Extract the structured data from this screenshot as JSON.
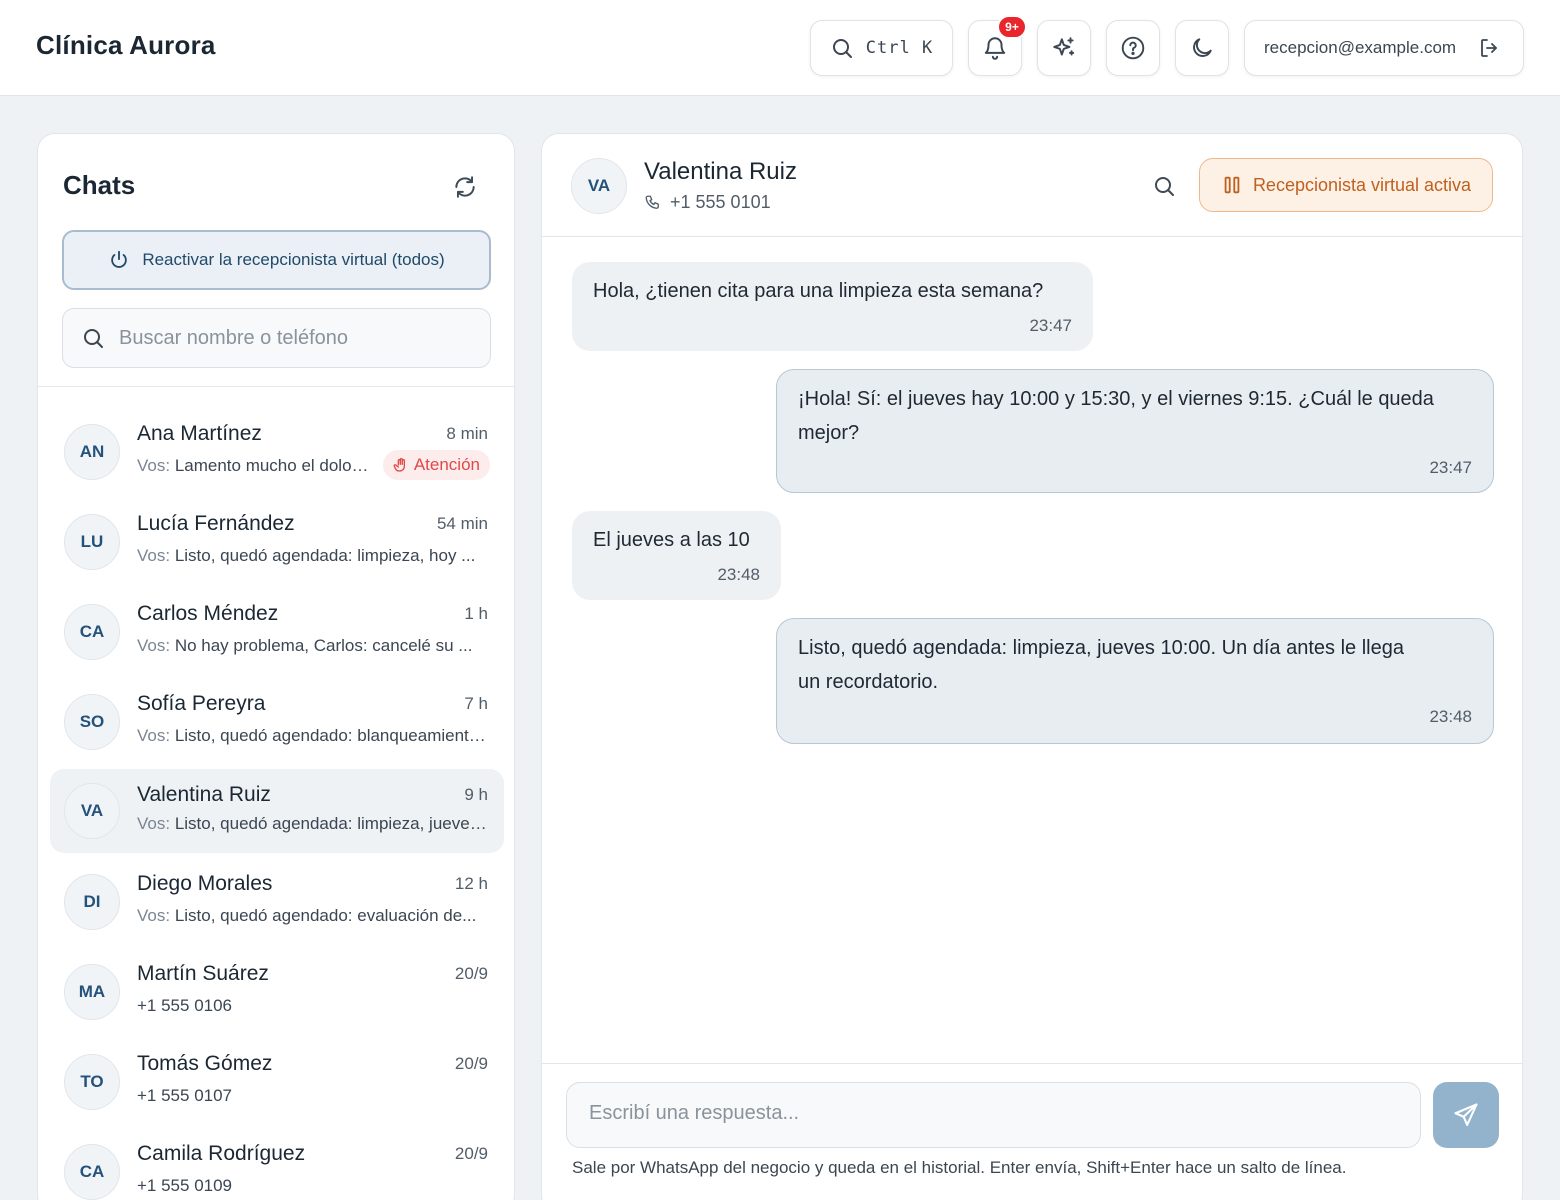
{
  "app": {
    "brand": "Clínica Aurora"
  },
  "topbar": {
    "search_shortcut": "Ctrl K",
    "notifications_badge": "9+",
    "user_email": "recepcion@example.com"
  },
  "sidebar": {
    "title": "Chats",
    "reactivate_label": "Reactivar la recepcionista virtual (todos)",
    "search_placeholder": "Buscar nombre o teléfono",
    "chats": [
      {
        "initials": "AN",
        "name": "Ana Martínez",
        "time": "8 min",
        "prefix": "Vos: ",
        "preview": "Lamento mucho el dolor...",
        "badge": "Atención"
      },
      {
        "initials": "LU",
        "name": "Lucía Fernández",
        "time": "54 min",
        "prefix": "Vos: ",
        "preview": "Listo, quedó agendada: limpieza, hoy ..."
      },
      {
        "initials": "CA",
        "name": "Carlos Méndez",
        "time": "1 h",
        "prefix": "Vos: ",
        "preview": "No hay problema, Carlos: cancelé su ..."
      },
      {
        "initials": "SO",
        "name": "Sofía Pereyra",
        "time": "7 h",
        "prefix": "Vos: ",
        "preview": "Listo, quedó agendado: blanqueamiento..."
      },
      {
        "initials": "VA",
        "name": "Valentina Ruiz",
        "time": "9 h",
        "prefix": "Vos: ",
        "preview": "Listo, quedó agendada: limpieza, jueves...",
        "active": true
      },
      {
        "initials": "DI",
        "name": "Diego Morales",
        "time": "12 h",
        "prefix": "Vos: ",
        "preview": "Listo, quedó agendado: evaluación de..."
      },
      {
        "initials": "MA",
        "name": "Martín Suárez",
        "time": "20/9",
        "prefix": "",
        "preview": "+1 555 0106"
      },
      {
        "initials": "TO",
        "name": "Tomás Gómez",
        "time": "20/9",
        "prefix": "",
        "preview": "+1 555 0107"
      },
      {
        "initials": "CA",
        "name": "Camila Rodríguez",
        "time": "20/9",
        "prefix": "",
        "preview": "+1 555 0109"
      }
    ]
  },
  "conversation": {
    "initials": "VA",
    "name": "Valentina Ruiz",
    "phone": "+1 555 0101",
    "agent_status": "Recepcionista virtual activa",
    "messages": [
      {
        "direction": "in",
        "lines": [
          "Hola, ¿tienen cita para una limpieza esta semana?"
        ],
        "time": "23:47"
      },
      {
        "direction": "out",
        "lines": [
          "¡Hola! Sí: el jueves hay 10:00 y 15:30, y el viernes 9:15. ¿Cuál le queda",
          "mejor?"
        ],
        "time": "23:47"
      },
      {
        "direction": "in",
        "lines": [
          "El jueves a las 10"
        ],
        "time": "23:48"
      },
      {
        "direction": "out",
        "lines": [
          "Listo, quedó agendada: limpieza, jueves 10:00. Un día antes le llega",
          "un recordatorio."
        ],
        "time": "23:48"
      }
    ],
    "composer_placeholder": "Escribí una respuesta...",
    "hint": "Sale por WhatsApp del negocio y queda en el historial. Enter envía, Shift+Enter hace un salto de línea."
  },
  "colors": {
    "accent": "#24527a",
    "attention": "#e14848",
    "agent_orange": "#c0601e",
    "notification_red": "#e8262b"
  }
}
